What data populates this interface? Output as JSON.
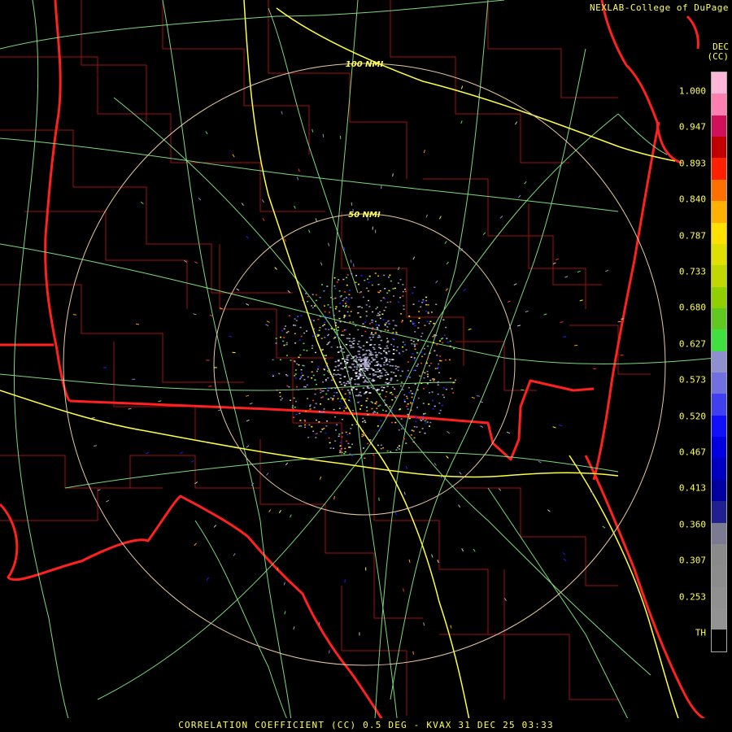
{
  "map": {
    "credit": "NEXLAB-College of DuPage",
    "ring_labels": [
      "100 NMI",
      "50 NMI"
    ],
    "colors": {
      "background": "#000000",
      "county_borders": "#a01010",
      "state_borders": "#ff2020",
      "highways": "#7ed87e",
      "interstates": "#ffff40",
      "range_rings": "#e8c8a0"
    }
  },
  "legend": {
    "header": [
      "DEC",
      "(CC)"
    ],
    "ticks": [
      "1.000",
      "0.947",
      "0.893",
      "0.840",
      "0.787",
      "0.733",
      "0.680",
      "0.627",
      "0.573",
      "0.520",
      "0.467",
      "0.413",
      "0.360",
      "0.307",
      "0.253",
      "TH"
    ],
    "color_stops": [
      "#ffb6d8",
      "#ff7fb0",
      "#d0105a",
      "#c00000",
      "#ff2000",
      "#ff7000",
      "#ffb000",
      "#ffe000",
      "#e0e000",
      "#c0d800",
      "#90d000",
      "#60c820",
      "#40e040",
      "#9090d0",
      "#7070e0",
      "#4040f0",
      "#1010ff",
      "#0000e0",
      "#0000c0",
      "#0000a0",
      "#202090",
      "#7a7a90",
      "#8a8a8a",
      "#8c8c8c",
      "#909090",
      "#939393",
      "#000000"
    ]
  },
  "footer": {
    "caption": "CORRELATION COEFFICIENT (CC) 0.5 DEG - KVAX 31 DEC 25 03:33"
  }
}
